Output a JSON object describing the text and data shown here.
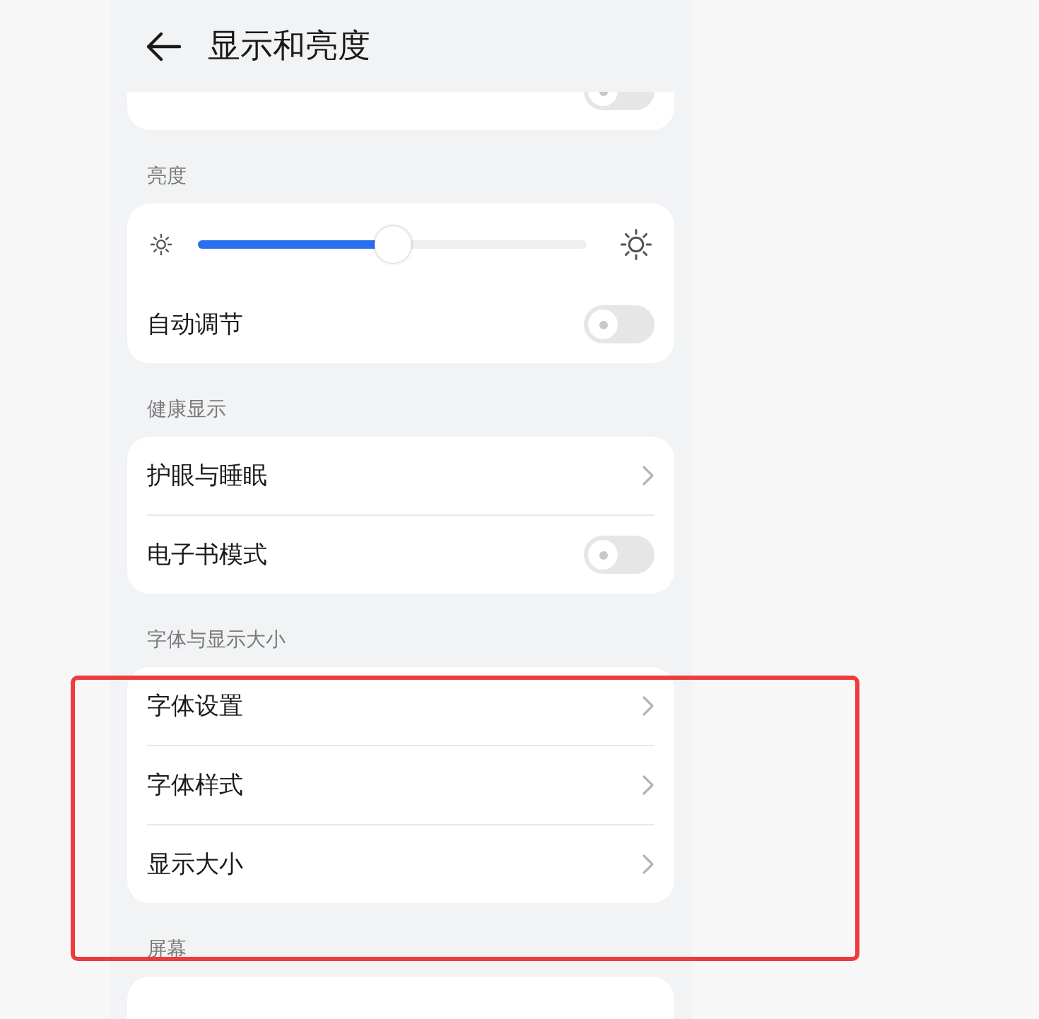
{
  "header": {
    "title": "显示和亮度"
  },
  "sections": [
    {
      "items": [
        {
          "kind": "toggle",
          "on": false
        }
      ]
    },
    {
      "label": "亮度",
      "items": [
        {
          "kind": "slider",
          "level": 0.5
        },
        {
          "kind": "toggle",
          "label": "自动调节",
          "on": false
        }
      ]
    },
    {
      "label": "健康显示",
      "items": [
        {
          "kind": "link",
          "label": "护眼与睡眠"
        },
        {
          "kind": "toggle",
          "label": "电子书模式",
          "on": false
        }
      ]
    },
    {
      "label": "字体与显示大小",
      "items": [
        {
          "kind": "link",
          "label": "字体设置"
        },
        {
          "kind": "link",
          "label": "字体样式"
        },
        {
          "kind": "link",
          "label": "显示大小"
        }
      ]
    },
    {
      "label": "屏幕",
      "items": [
        {
          "kind": "blank"
        }
      ]
    }
  ],
  "highlight_frame": true
}
